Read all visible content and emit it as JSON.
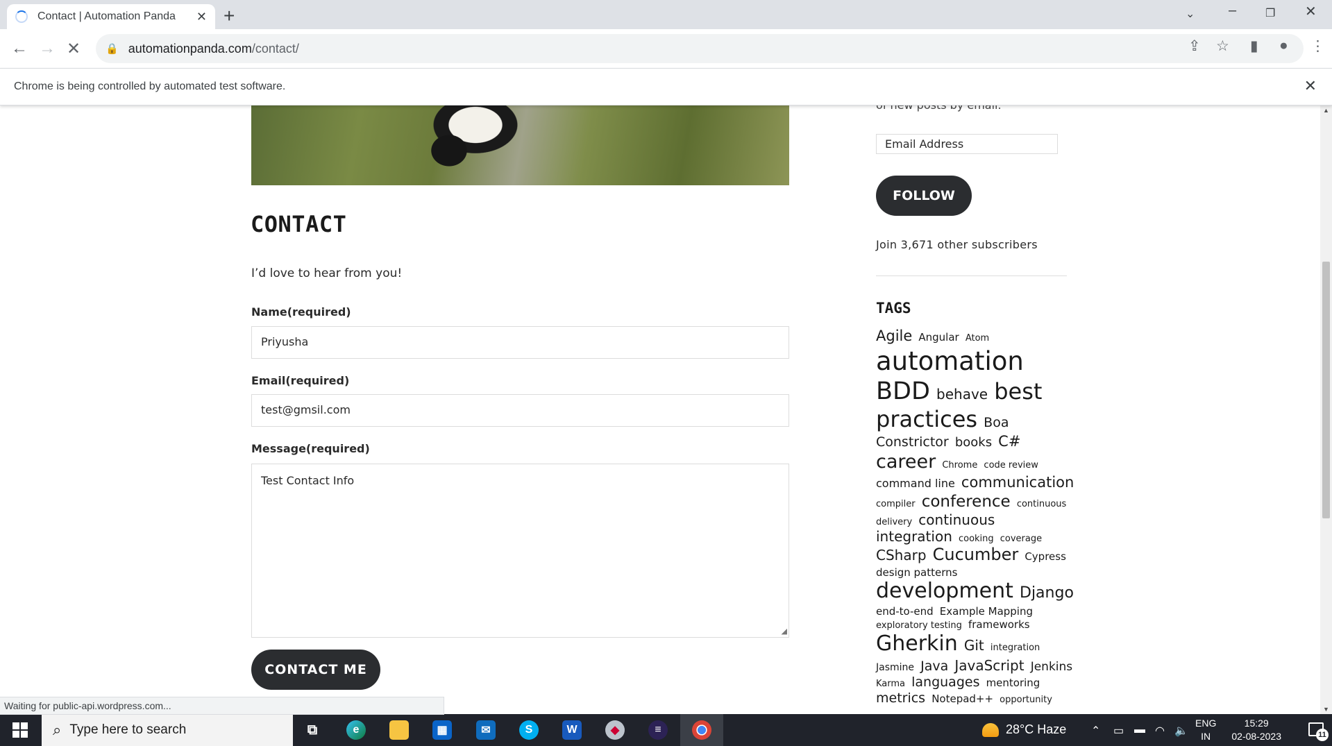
{
  "browser": {
    "tab_title": "Contact | Automation Panda",
    "url_host": "automationpanda.com",
    "url_path": "/contact/",
    "infobar_text": "Chrome is being controlled by automated test software.",
    "status_text": "Waiting for public-api.wordpress.com..."
  },
  "page": {
    "title": "CONTACT",
    "intro": "I’d love to hear from you!",
    "form": {
      "name_label": "Name(required)",
      "name_value": "Priyusha",
      "email_label": "Email(required)",
      "email_value": "test@gmsil.com",
      "message_label": "Message(required)",
      "message_value": "Test Contact Info",
      "submit_label": "CONTACT ME"
    }
  },
  "sidebar": {
    "cut_text": "of new posts by email.",
    "email_placeholder": "Email Address",
    "follow_label": "FOLLOW",
    "subscribers_text": "Join 3,671 other subscribers",
    "tags_title": "TAGS",
    "tags": [
      {
        "label": "Agile",
        "size": 21
      },
      {
        "label": "Angular",
        "size": 15
      },
      {
        "label": "Atom",
        "size": 13
      },
      {
        "label": "automation",
        "size": 37
      },
      {
        "label": "BDD",
        "size": 35
      },
      {
        "label": "behave",
        "size": 20
      },
      {
        "label": "best practices",
        "size": 32
      },
      {
        "label": "Boa Constrictor",
        "size": 19
      },
      {
        "label": "books",
        "size": 18
      },
      {
        "label": "C#",
        "size": 21
      },
      {
        "label": "career",
        "size": 27
      },
      {
        "label": "Chrome",
        "size": 13
      },
      {
        "label": "code review",
        "size": 13
      },
      {
        "label": "command line",
        "size": 16
      },
      {
        "label": "communication",
        "size": 21
      },
      {
        "label": "compiler",
        "size": 13
      },
      {
        "label": "conference",
        "size": 23
      },
      {
        "label": "continuous delivery",
        "size": 13
      },
      {
        "label": "continuous integration",
        "size": 20
      },
      {
        "label": "cooking",
        "size": 13
      },
      {
        "label": "coverage",
        "size": 13
      },
      {
        "label": "CSharp",
        "size": 20
      },
      {
        "label": "Cucumber",
        "size": 24
      },
      {
        "label": "Cypress",
        "size": 15
      },
      {
        "label": "design patterns",
        "size": 15
      },
      {
        "label": "development",
        "size": 30
      },
      {
        "label": "Django",
        "size": 22
      },
      {
        "label": "end-to-end",
        "size": 15
      },
      {
        "label": "Example Mapping",
        "size": 15
      },
      {
        "label": "exploratory testing",
        "size": 13
      },
      {
        "label": "frameworks",
        "size": 15
      },
      {
        "label": "Gherkin",
        "size": 30
      },
      {
        "label": "Git",
        "size": 20
      },
      {
        "label": "integration",
        "size": 13
      },
      {
        "label": "Jasmine",
        "size": 14
      },
      {
        "label": "Java",
        "size": 19
      },
      {
        "label": "JavaScript",
        "size": 20
      },
      {
        "label": "Jenkins",
        "size": 17
      },
      {
        "label": "Karma",
        "size": 13
      },
      {
        "label": "languages",
        "size": 19
      },
      {
        "label": "mentoring",
        "size": 15
      },
      {
        "label": "metrics",
        "size": 19
      },
      {
        "label": "Notepad++",
        "size": 15
      },
      {
        "label": "opportunity",
        "size": 13
      }
    ]
  },
  "taskbar": {
    "search_placeholder": "Type here to search",
    "weather": "28°C  Haze",
    "lang_1": "ENG",
    "lang_2": "IN",
    "time": "15:29",
    "date": "02-08-2023",
    "notif_count": "11"
  }
}
